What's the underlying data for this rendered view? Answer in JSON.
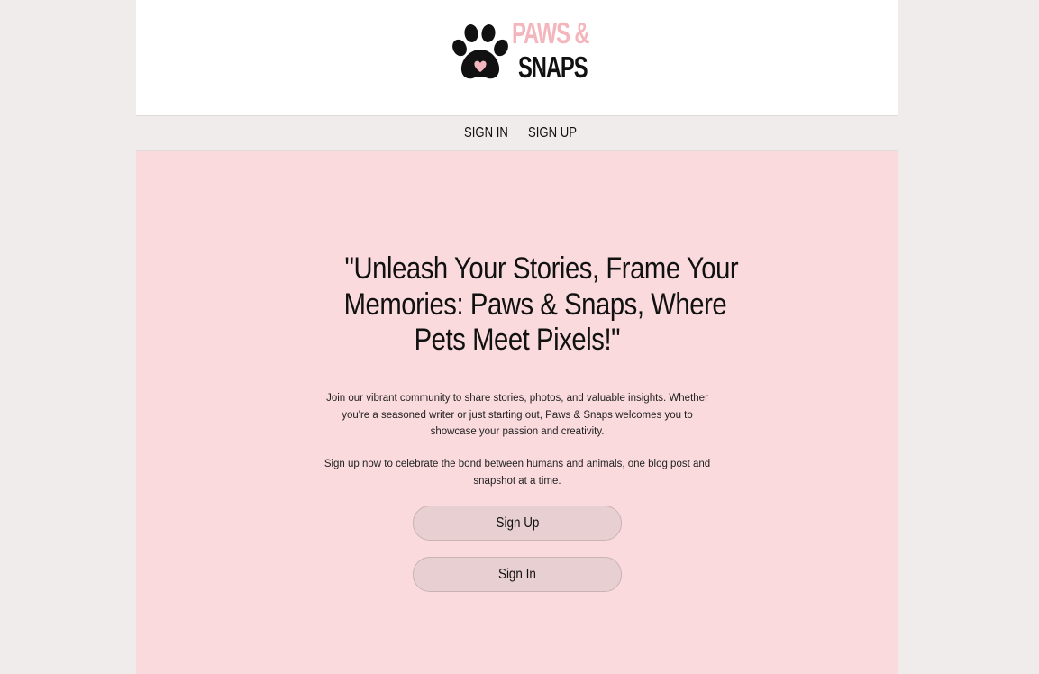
{
  "brand": {
    "line1": "PAWS &",
    "line2": "SNAPS",
    "logo_icon": "paw-print-icon",
    "colors": {
      "pink": "#f4b6bd",
      "dark": "#111111"
    }
  },
  "nav": {
    "sign_in": "SIGN IN",
    "sign_up": "SIGN UP"
  },
  "hero": {
    "title_lines": [
      "\"Unleash Your Stories, Frame Your",
      "Memories: Paws & Snaps, Where",
      "Pets Meet Pixels!\""
    ],
    "paragraph1": "Join our vibrant community to share stories, photos, and valuable insights. Whether you're a seasoned writer or just starting out, Paws & Snaps welcomes you to showcase your passion and creativity.",
    "paragraph2": "Sign up now to celebrate the bond between humans and animals, one blog post and snapshot at a time.",
    "signup_button": "Sign Up",
    "signin_button": "Sign In"
  },
  "colors": {
    "page_bg": "#f0eceb",
    "hero_bg": "#fadadd",
    "header_bg": "#ffffff",
    "button_bg": "#e8cfd1"
  }
}
